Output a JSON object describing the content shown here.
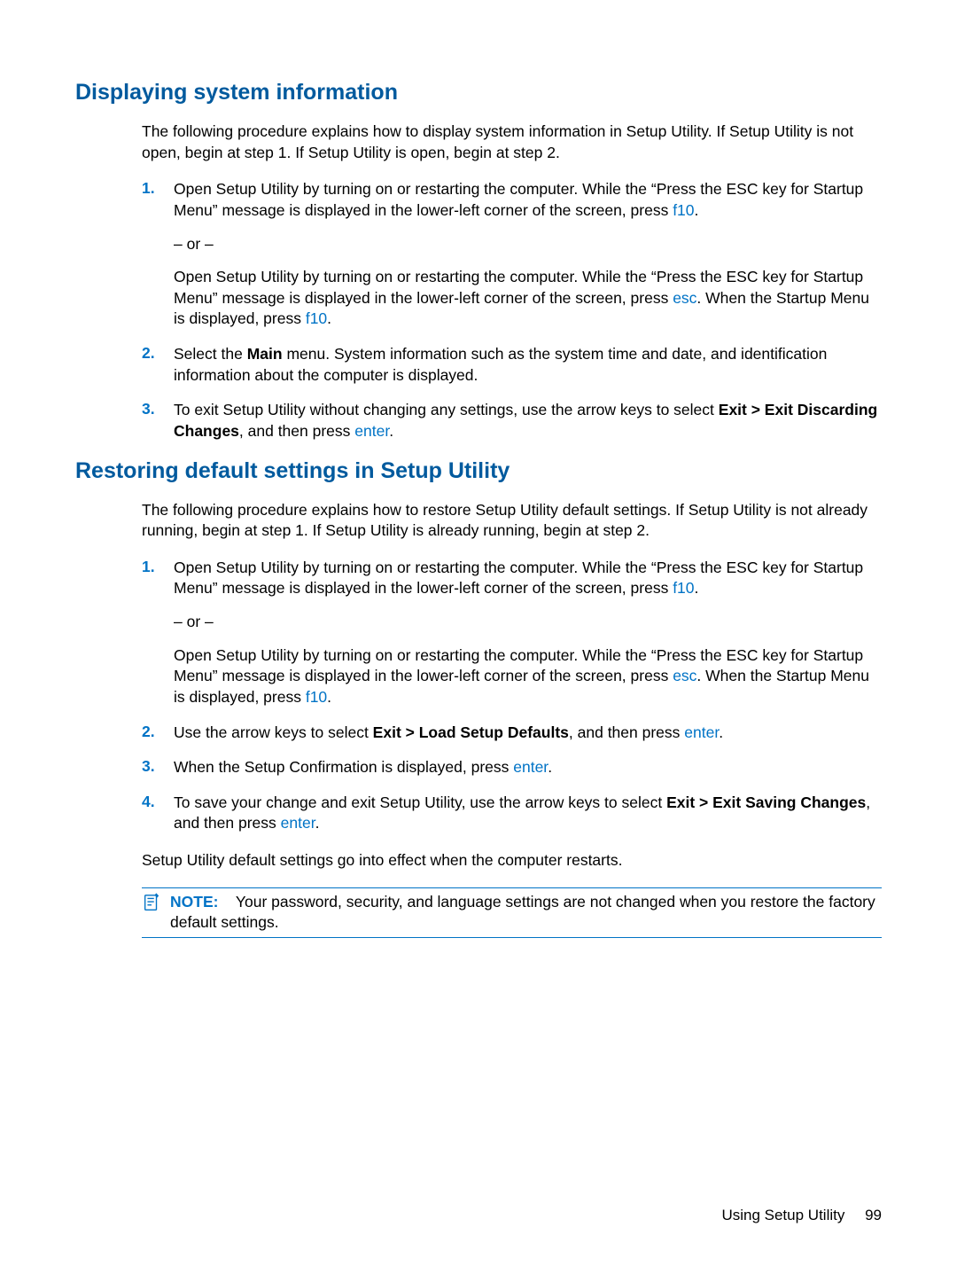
{
  "sections": [
    {
      "heading": "Displaying system information",
      "intro": "The following procedure explains how to display system information in Setup Utility. If Setup Utility is not open, begin at step 1. If Setup Utility is open, begin at step 2.",
      "steps": [
        {
          "num": "1.",
          "p1a": "Open Setup Utility by turning on or restarting the computer. While the “Press the ESC key for Startup Menu” message is displayed in the lower-left corner of the screen, press ",
          "p1key": "f10",
          "p1b": ".",
          "or": "– or –",
          "p2a": "Open Setup Utility by turning on or restarting the computer. While the “Press the ESC key for Startup Menu” message is displayed in the lower-left corner of the screen, press ",
          "p2key1": "esc",
          "p2b": ". When the Startup Menu is displayed, press ",
          "p2key2": "f10",
          "p2c": "."
        },
        {
          "num": "2.",
          "text_a": "Select the ",
          "bold": "Main",
          "text_b": " menu. System information such as the system time and date, and identification information about the computer is displayed."
        },
        {
          "num": "3.",
          "text_a": "To exit Setup Utility without changing any settings, use the arrow keys to select ",
          "bold": "Exit > Exit Discarding Changes",
          "text_b": ", and then press ",
          "key": "enter",
          "text_c": "."
        }
      ]
    },
    {
      "heading": "Restoring default settings in Setup Utility",
      "intro": "The following procedure explains how to restore Setup Utility default settings. If Setup Utility is not already running, begin at step 1. If Setup Utility is already running, begin at step 2.",
      "steps": [
        {
          "num": "1.",
          "p1a": "Open Setup Utility by turning on or restarting the computer. While the “Press the ESC key for Startup Menu” message is displayed in the lower-left corner of the screen, press ",
          "p1key": "f10",
          "p1b": ".",
          "or": "– or –",
          "p2a": "Open Setup Utility by turning on or restarting the computer. While the “Press the ESC key for Startup Menu” message is displayed in the lower-left corner of the screen, press ",
          "p2key1": "esc",
          "p2b": ". When the Startup Menu is displayed, press ",
          "p2key2": "f10",
          "p2c": "."
        },
        {
          "num": "2.",
          "text_a": "Use the arrow keys to select ",
          "bold": "Exit > Load Setup Defaults",
          "text_b": ", and then press ",
          "key": "enter",
          "text_c": "."
        },
        {
          "num": "3.",
          "text_a": "When the Setup Confirmation is displayed, press ",
          "key": "enter",
          "text_c": "."
        },
        {
          "num": "4.",
          "text_a": "To save your change and exit Setup Utility, use the arrow keys to select ",
          "bold": "Exit > Exit Saving Changes",
          "text_b": ", and then press ",
          "key": "enter",
          "text_c": "."
        }
      ],
      "outro": "Setup Utility default settings go into effect when the computer restarts.",
      "note": {
        "label": "NOTE:",
        "text": "Your password, security, and language settings are not changed when you restore the factory default settings."
      }
    }
  ],
  "footer": {
    "text": "Using Setup Utility",
    "page": "99"
  }
}
